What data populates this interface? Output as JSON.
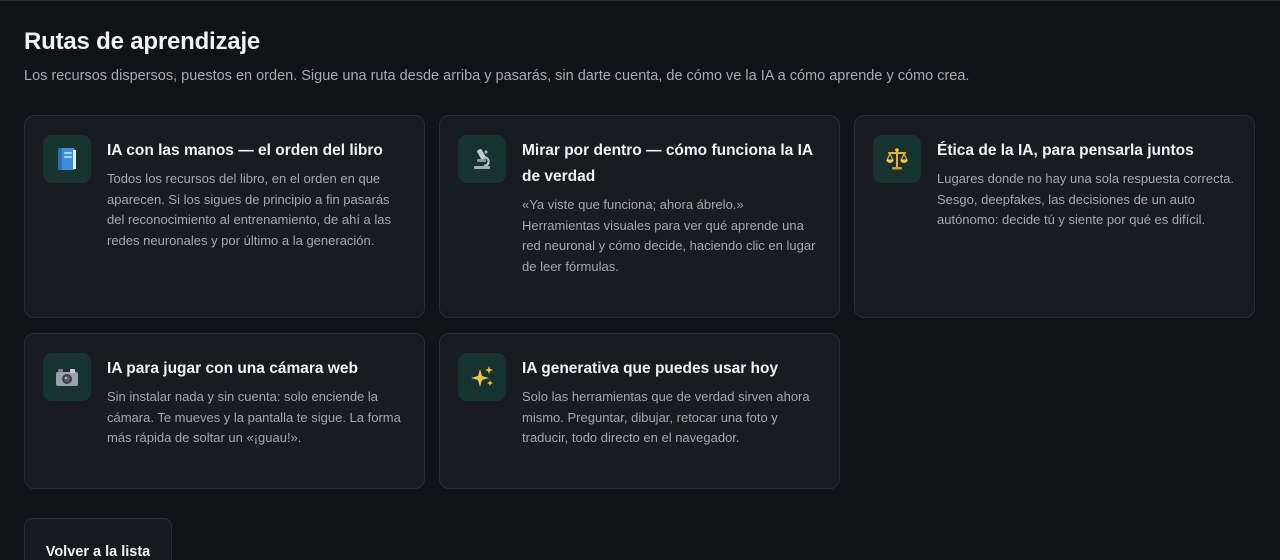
{
  "header": {
    "title": "Rutas de aprendizaje",
    "subtitle": "Los recursos dispersos, puestos en orden. Sigue una ruta desde arriba y pasarás, sin darte cuenta, de cómo ve la IA a cómo aprende y cómo crea."
  },
  "cards": [
    {
      "icon": "book-icon",
      "title": "IA con las manos — el orden del libro",
      "description": "Todos los recursos del libro, en el orden en que aparecen. Si los sigues de principio a fin pasarás del reconocimiento al entrenamiento, de ahí a las redes neuronales y por último a la generación."
    },
    {
      "icon": "microscope-icon",
      "title": "Mirar por dentro — cómo funciona la IA de verdad",
      "description": "«Ya viste que funciona; ahora ábrelo.» Herramientas visuales para ver qué aprende una red neuronal y cómo decide, haciendo clic en lugar de leer fórmulas."
    },
    {
      "icon": "balance-scale-icon",
      "title": "Ética de la IA, para pensarla juntos",
      "description": "Lugares donde no hay una sola respuesta correcta. Sesgo, deepfakes, las decisiones de un auto autónomo: decide tú y siente por qué es difícil."
    },
    {
      "icon": "camera-icon",
      "title": "IA para jugar con una cámara web",
      "description": "Sin instalar nada y sin cuenta: solo enciende la cámara. Te mueves y la pantalla te sigue. La forma más rápida de soltar un «¡guau!»."
    },
    {
      "icon": "sparkles-icon",
      "title": "IA generativa que puedes usar hoy",
      "description": "Solo las herramientas que de verdad sirven ahora mismo. Preguntar, dibujar, retocar una foto y traducir, todo directo en el navegador."
    }
  ],
  "footer": {
    "back_label": "Volver a la lista"
  },
  "colors": {
    "background": "#111216",
    "card": "#1a1b21",
    "icon_tile": "#173330"
  }
}
